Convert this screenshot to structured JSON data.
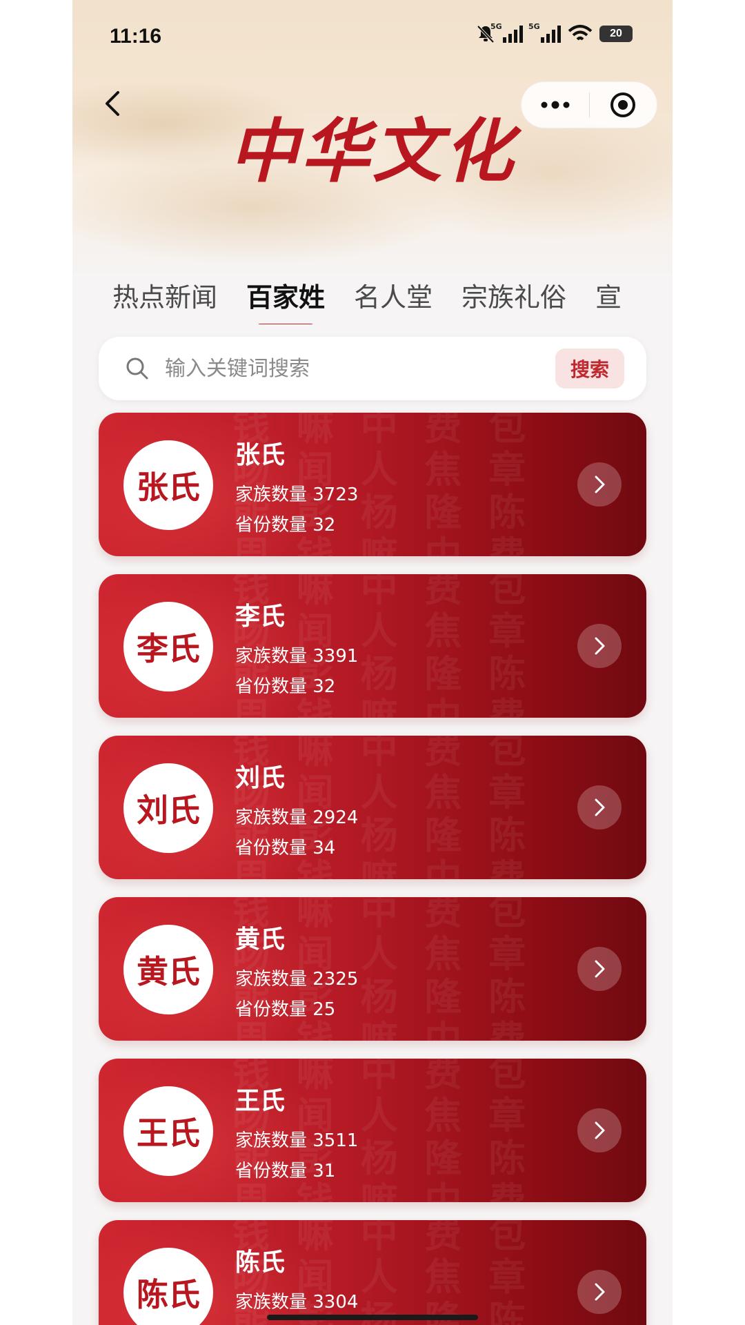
{
  "status_bar": {
    "time": "11:16",
    "network_1": "5G",
    "network_2": "5G",
    "battery": "20"
  },
  "header": {
    "title": "中华文化"
  },
  "tabs": [
    {
      "label": "热点新闻",
      "active": false
    },
    {
      "label": "百家姓",
      "active": true
    },
    {
      "label": "名人堂",
      "active": false
    },
    {
      "label": "宗族礼俗",
      "active": false
    },
    {
      "label": "宣",
      "active": false
    }
  ],
  "search": {
    "placeholder": "输入关键词搜索",
    "button_label": "搜索"
  },
  "cards": [
    {
      "avatar": "张氏",
      "name": "张氏",
      "family_count": "家族数量 3723",
      "province_count": "省份数量 32"
    },
    {
      "avatar": "李氏",
      "name": "李氏",
      "family_count": "家族数量 3391",
      "province_count": "省份数量 32"
    },
    {
      "avatar": "刘氏",
      "name": "刘氏",
      "family_count": "家族数量 2924",
      "province_count": "省份数量 34"
    },
    {
      "avatar": "黄氏",
      "name": "黄氏",
      "family_count": "家族数量 2325",
      "province_count": "省份数量 25"
    },
    {
      "avatar": "王氏",
      "name": "王氏",
      "family_count": "家族数量 3511",
      "province_count": "省份数量 31"
    },
    {
      "avatar": "陈氏",
      "name": "陈氏",
      "family_count": "家族数量 3304",
      "province_count": ""
    }
  ],
  "colors": {
    "accent": "#c0282f",
    "card_start": "#cf2630",
    "card_end": "#6f0a10"
  }
}
